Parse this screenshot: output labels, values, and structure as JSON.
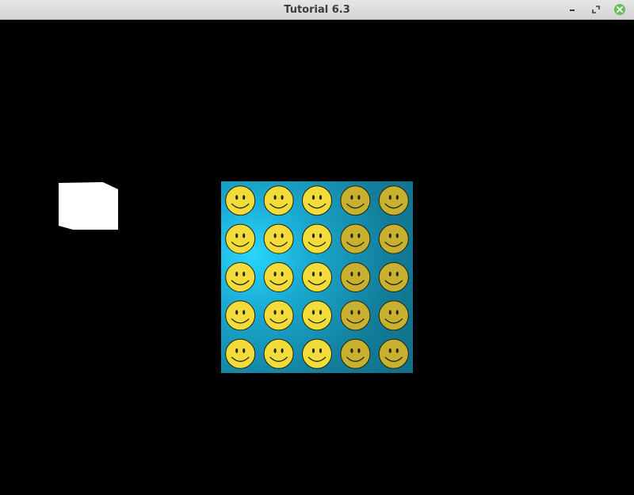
{
  "window": {
    "title": "Tutorial 6.3",
    "controls": [
      {
        "name": "minimize-button",
        "icon": "minimize-icon"
      },
      {
        "name": "maximize-button",
        "icon": "maximize-icon"
      },
      {
        "name": "close-button",
        "icon": "close-icon"
      }
    ],
    "close_color": "#6bbf5a"
  },
  "scene": {
    "background": "#000000",
    "cube_color": "#ffffff",
    "quad": {
      "rows": 5,
      "cols": 5,
      "texture_icon": "smiley-face-icon",
      "colors": {
        "highlight": "#29d6ff",
        "base": "#127c99",
        "face": "#f2dc3c",
        "face_dark": "#c8b030",
        "outline": "#2a2200"
      }
    }
  }
}
